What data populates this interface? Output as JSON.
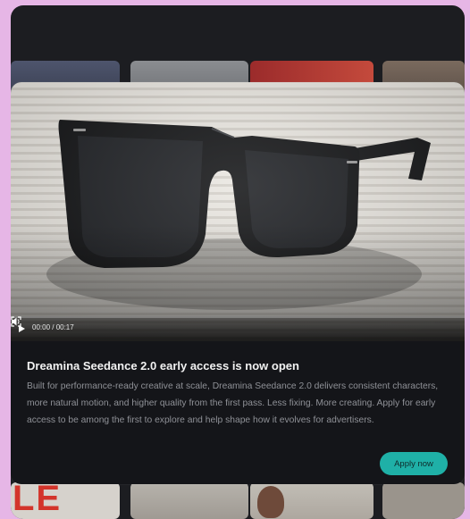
{
  "video": {
    "time_display": "00:00 / 00:17",
    "progress_fraction": 0.0,
    "state": "paused",
    "icons": {
      "play": "play-icon",
      "volume": "volume-icon",
      "fullscreen": "fullscreen-icon"
    }
  },
  "announcement": {
    "title": "Dreamina Seedance 2.0 early access is now open",
    "description": "Built for performance-ready creative at scale, Dreamina Seedance 2.0 delivers consistent characters, more natural motion, and higher quality from the first pass. Less fixing. More creating. Apply for early access to be among the first to explore and help shape how it evolves for advertisers.",
    "cta_label": "Apply now"
  },
  "background_tiles": {
    "bottom_left_text": "LE"
  },
  "colors": {
    "page_background": "#e6b6e6",
    "panel_background": "#1c1d21",
    "modal_background": "#141519",
    "accent": "#1fb0a7"
  }
}
